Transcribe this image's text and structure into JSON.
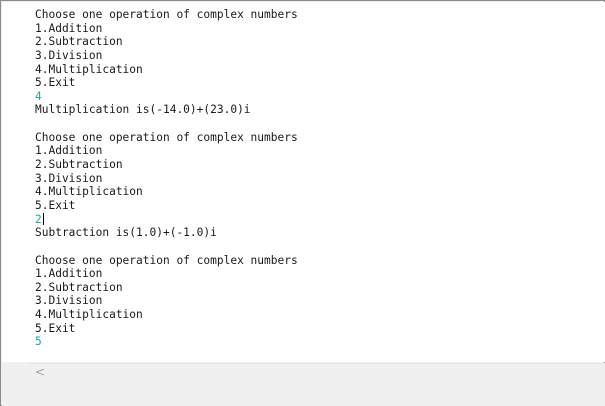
{
  "console": {
    "blocks": [
      {
        "menu_title": "Choose one operation of complex numbers",
        "options": [
          "1.Addition",
          "2.Subtraction",
          "3.Division",
          "4.Multiplication",
          "5.Exit"
        ],
        "input": "4",
        "result": "Multiplication is(-14.0)+(23.0)i"
      },
      {
        "menu_title": "Choose one operation of complex numbers",
        "options": [
          "1.Addition",
          "2.Subtraction",
          "3.Division",
          "4.Multiplication",
          "5.Exit"
        ],
        "input": "2",
        "result": "Subtraction is(1.0)+(-1.0)i"
      },
      {
        "menu_title": "Choose one operation of complex numbers",
        "options": [
          "1.Addition",
          "2.Subtraction",
          "3.Division",
          "4.Multiplication",
          "5.Exit"
        ],
        "input": "5"
      }
    ],
    "input_color": "#22a59a"
  },
  "scrollbar": {
    "left_arrow_icon": "chevron-left-icon",
    "left_arrow_glyph": "<"
  }
}
